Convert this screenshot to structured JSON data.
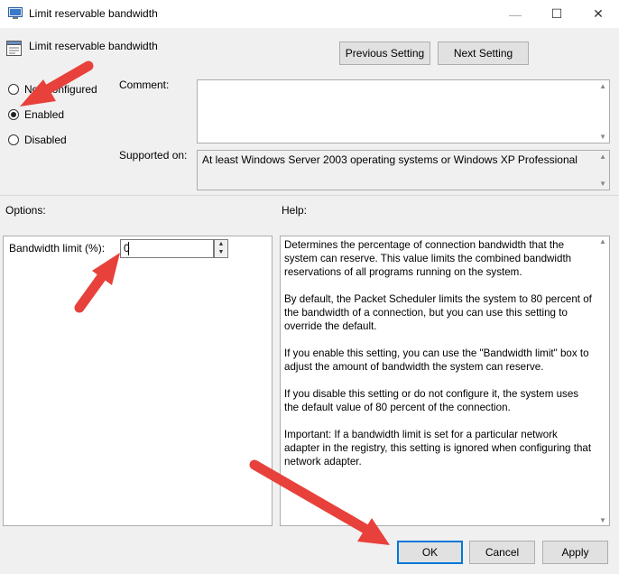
{
  "window": {
    "title": "Limit reservable bandwidth",
    "controls": {
      "minimize": "—",
      "maximize": "☐",
      "close": "✕"
    }
  },
  "header": {
    "policy_name": "Limit reservable bandwidth",
    "prev_label": "Previous Setting",
    "next_label": "Next Setting"
  },
  "state": {
    "options": [
      {
        "label": "Not Configured",
        "selected": false
      },
      {
        "label": "Enabled",
        "selected": true
      },
      {
        "label": "Disabled",
        "selected": false
      }
    ]
  },
  "comment": {
    "label": "Comment:",
    "value": ""
  },
  "supported": {
    "label": "Supported on:",
    "value": "At least Windows Server 2003 operating systems or Windows XP Professional"
  },
  "options_section": {
    "label": "Options:",
    "bandwidth_label": "Bandwidth limit (%):",
    "bandwidth_value": "0"
  },
  "help_section": {
    "label": "Help:",
    "paragraphs": [
      "Determines the percentage of connection bandwidth that the system can reserve. This value limits the combined bandwidth reservations of all programs running on the system.",
      "By default, the Packet Scheduler limits the system to 80 percent of the bandwidth of a connection, but you can use this setting to override the default.",
      "If you enable this setting, you can use the \"Bandwidth limit\" box to adjust the amount of bandwidth the system can reserve.",
      "If you disable this setting or do not configure it, the system uses the default value of 80 percent of the connection.",
      "Important: If a bandwidth limit is set for a particular network adapter in the registry, this setting is ignored when configuring that network adapter."
    ]
  },
  "footer": {
    "ok": "OK",
    "cancel": "Cancel",
    "apply": "Apply"
  },
  "colors": {
    "annotation_arrow": "#e8413b",
    "focus_border": "#0078d7"
  }
}
